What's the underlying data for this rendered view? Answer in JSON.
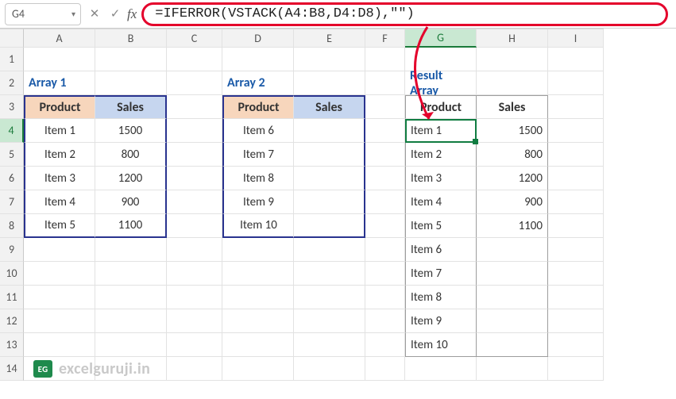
{
  "namebox": {
    "value": "G4"
  },
  "formula": {
    "value": "=IFERROR(VSTACK(A4:B8,D4:D8),\"\")"
  },
  "columns": [
    "A",
    "B",
    "C",
    "D",
    "E",
    "F",
    "G",
    "H",
    "I"
  ],
  "rows": [
    "1",
    "2",
    "3",
    "4",
    "5",
    "6",
    "7",
    "8",
    "9",
    "10",
    "11",
    "12",
    "13",
    "14"
  ],
  "highlight": {
    "col": "G",
    "row": "4"
  },
  "array1": {
    "title": "Array 1",
    "headers": [
      "Product",
      "Sales"
    ],
    "rows": [
      {
        "product": "Item 1",
        "sales": "1500"
      },
      {
        "product": "Item 2",
        "sales": "800"
      },
      {
        "product": "Item 3",
        "sales": "1200"
      },
      {
        "product": "Item 4",
        "sales": "900"
      },
      {
        "product": "Item 5",
        "sales": "1100"
      }
    ]
  },
  "array2": {
    "title": "Array 2",
    "headers": [
      "Product",
      "Sales"
    ],
    "rows": [
      {
        "product": "Item 6",
        "sales": ""
      },
      {
        "product": "Item 7",
        "sales": ""
      },
      {
        "product": "Item 8",
        "sales": ""
      },
      {
        "product": "Item 9",
        "sales": ""
      },
      {
        "product": "Item 10",
        "sales": ""
      }
    ]
  },
  "result": {
    "title": "Result Array",
    "headers": [
      "Product",
      "Sales"
    ],
    "rows": [
      {
        "product": "Item 1",
        "sales": "1500"
      },
      {
        "product": "Item 2",
        "sales": "800"
      },
      {
        "product": "Item 3",
        "sales": "1200"
      },
      {
        "product": "Item 4",
        "sales": "900"
      },
      {
        "product": "Item 5",
        "sales": "1100"
      },
      {
        "product": "Item 6",
        "sales": ""
      },
      {
        "product": "Item 7",
        "sales": ""
      },
      {
        "product": "Item 8",
        "sales": ""
      },
      {
        "product": "Item 9",
        "sales": ""
      },
      {
        "product": "Item 10",
        "sales": ""
      }
    ]
  },
  "watermark": {
    "badge": "EG",
    "text": "excelguruji.in"
  },
  "colors": {
    "accent_red": "#e4002b",
    "accent_green": "#107c41",
    "border_blue": "#29338f"
  },
  "chart_data": {
    "type": "table",
    "title": "VSTACK with IFERROR example",
    "tables": [
      {
        "name": "Array 1",
        "range": "A3:B8",
        "columns": [
          "Product",
          "Sales"
        ],
        "rows": [
          [
            "Item 1",
            1500
          ],
          [
            "Item 2",
            800
          ],
          [
            "Item 3",
            1200
          ],
          [
            "Item 4",
            900
          ],
          [
            "Item 5",
            1100
          ]
        ]
      },
      {
        "name": "Array 2",
        "range": "D3:E8",
        "columns": [
          "Product",
          "Sales"
        ],
        "rows": [
          [
            "Item 6",
            null
          ],
          [
            "Item 7",
            null
          ],
          [
            "Item 8",
            null
          ],
          [
            "Item 9",
            null
          ],
          [
            "Item 10",
            null
          ]
        ]
      },
      {
        "name": "Result Array",
        "range": "G3:H13",
        "formula_cell": "G4",
        "formula": "=IFERROR(VSTACK(A4:B8,D4:D8),\"\")",
        "columns": [
          "Product",
          "Sales"
        ],
        "rows": [
          [
            "Item 1",
            1500
          ],
          [
            "Item 2",
            800
          ],
          [
            "Item 3",
            1200
          ],
          [
            "Item 4",
            900
          ],
          [
            "Item 5",
            1100
          ],
          [
            "Item 6",
            null
          ],
          [
            "Item 7",
            null
          ],
          [
            "Item 8",
            null
          ],
          [
            "Item 9",
            null
          ],
          [
            "Item 10",
            null
          ]
        ]
      }
    ]
  }
}
